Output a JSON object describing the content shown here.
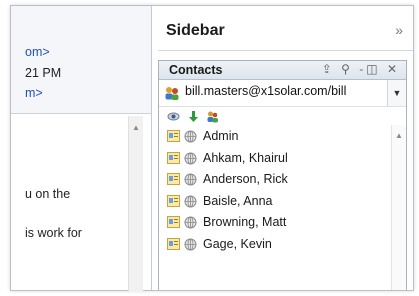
{
  "email": {
    "header_lines": [
      "om>",
      "21 PM",
      "m>"
    ],
    "body_lines": [
      "u on the",
      "is work for"
    ]
  },
  "sidebar": {
    "title": "Sidebar",
    "collapse_glyph": "»",
    "contacts": {
      "title": "Contacts",
      "controls": [
        "⇪",
        "⚲",
        "-◫",
        "✕"
      ],
      "account": "bill.masters@x1solar.com/bill",
      "toolbar_icons": [
        "eye-icon",
        "download-arrow-icon",
        "people-icon"
      ],
      "items": [
        {
          "name": "Admin"
        },
        {
          "name": "Ahkam, Khairul"
        },
        {
          "name": "Anderson, Rick"
        },
        {
          "name": "Baisle, Anna"
        },
        {
          "name": "Browning, Matt"
        },
        {
          "name": "Gage, Kevin"
        }
      ]
    }
  },
  "colors": {
    "link": "#1f4fb8",
    "accent": "#a7b2bf"
  }
}
